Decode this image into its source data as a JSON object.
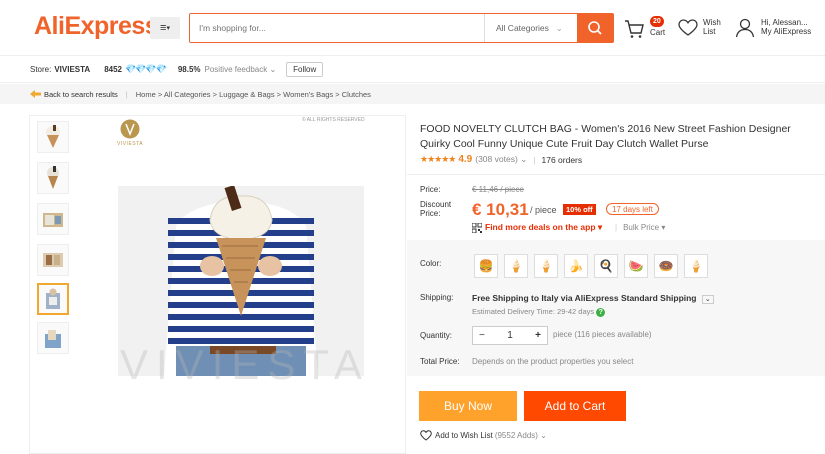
{
  "header": {
    "logo": "AliExpress",
    "logo_tm": "TM",
    "menu_caret": "▾",
    "search_placeholder": "I'm shopping for...",
    "search_category": "All Categories",
    "cart_count": "20",
    "cart_label": "Cart",
    "wish_label_1": "Wish",
    "wish_label_2": "List",
    "user_greeting": "Hi, Alessan...",
    "user_account": "My AliExpress"
  },
  "store": {
    "label": "Store:",
    "name": "VIVIESTA",
    "score": "8452",
    "diamonds": "💎💎💎💎",
    "feedback_pct": "98.5%",
    "feedback_label": "Positive feedback ⌄",
    "follow_label": "Follow"
  },
  "breadcrumb": {
    "back": "Back to search results",
    "path": "Home > All Categories > Luggage & Bags > Women's Bags > Clutches"
  },
  "gallery": {
    "brand": "VIVIESTA",
    "rights": "© ALL RIGHTS RESERVED",
    "watermark": "VIVIESTA"
  },
  "product": {
    "title": "FOOD NOVELTY CLUTCH BAG - Women's 2016 New Street Fashion Designer Quirky Cool Funny Unique Cute Fruit Day Clutch Wallet Purse",
    "stars": "★★★★★",
    "rating": "4.9",
    "votes": "(308 votes) ⌄",
    "orders": "176 orders",
    "price_label": "Price:",
    "old_price": "€ 11,46 / piece",
    "discount_label_1": "Discount",
    "discount_label_2": "Price:",
    "discount_price": "€ 10,31",
    "per_piece": "/ piece",
    "off_badge": "10% off",
    "days_left": "17 days left",
    "app_deal": "Find more deals on the app ▾",
    "bulk_price": "Bulk Price ▾",
    "color_label": "Color:",
    "color_swatches": [
      "🍔",
      "🍦",
      "🍦",
      "🍌",
      "🍳",
      "🍉",
      "🍩",
      "🍦"
    ],
    "shipping_label": "Shipping:",
    "shipping_text_bold": "Free Shipping to Italy via AliExpress Standard Shipping",
    "shipping_dropdown": "⌄",
    "delivery_time": "Estimated Delivery Time: 29-42 days",
    "quantity_label": "Quantity:",
    "quantity_value": "1",
    "quantity_minus": "−",
    "quantity_plus": "+",
    "quantity_available": "piece (116 pieces available)",
    "total_label": "Total Price:",
    "total_text": "Depends on the product properties you select",
    "buy_now": "Buy Now",
    "add_to_cart": "Add to Cart",
    "add_wishlist": "Add to Wish List",
    "wishlist_count": "(9552 Adds) ⌄"
  },
  "colors": {
    "brand_orange": "#f0632a",
    "buy_now": "#ffa22b",
    "add_to_cart": "#ff4800",
    "discount_red": "#e62e04",
    "star_orange": "#f0821c"
  }
}
